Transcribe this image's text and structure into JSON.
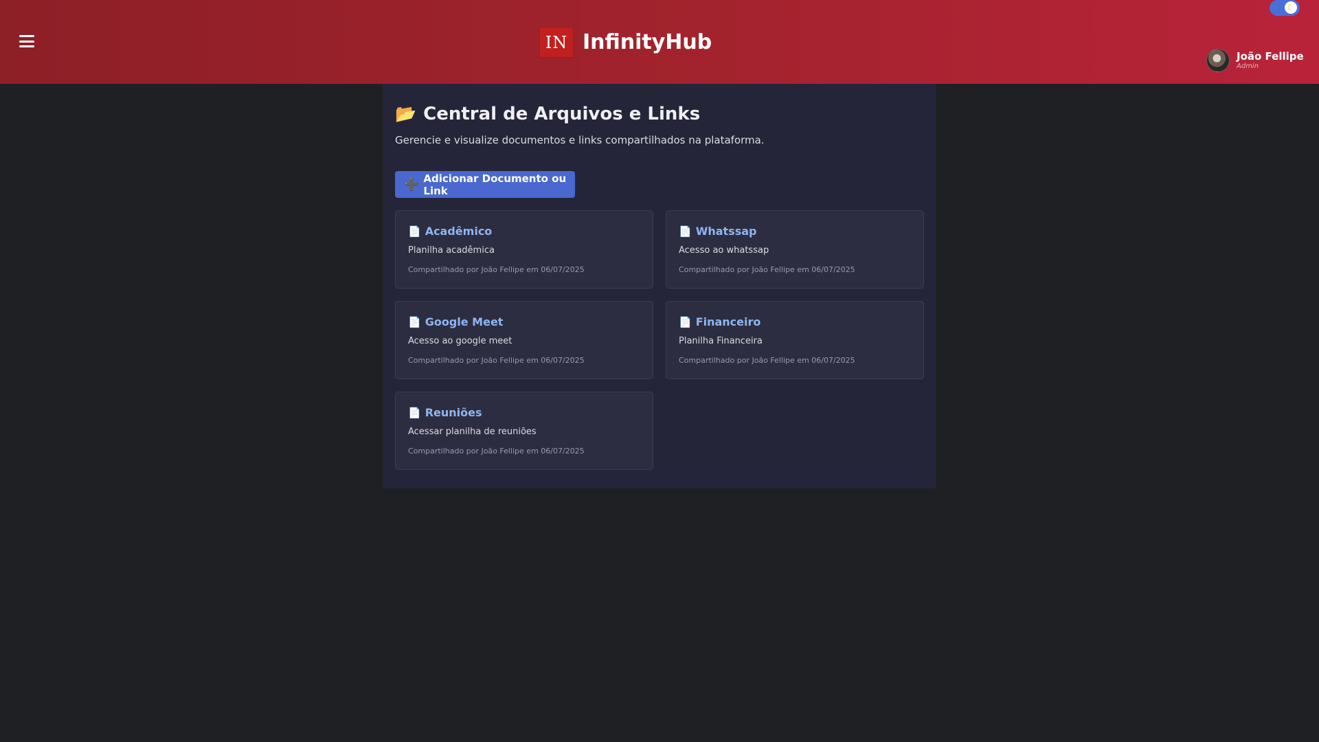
{
  "header": {
    "brand_logo_text": "IN",
    "brand_name": "InfinityHub",
    "theme_icon": "moon-icon",
    "user": {
      "name": "João Fellipe",
      "role": "Admin"
    }
  },
  "page": {
    "title_icon": "📂",
    "title": "Central de Arquivos e Links",
    "subtitle": "Gerencie e visualize documentos e links compartilhados na plataforma.",
    "add_button": {
      "icon": "➕",
      "label": "Adicionar Documento ou Link"
    }
  },
  "documents": [
    {
      "icon": "📄",
      "title": "Acadêmico",
      "description": "Planilha acadêmica",
      "meta": "Compartilhado por João Fellipe em 06/07/2025"
    },
    {
      "icon": "📄",
      "title": "Whatssap",
      "description": "Acesso ao whatssap",
      "meta": "Compartilhado por João Fellipe em 06/07/2025"
    },
    {
      "icon": "📄",
      "title": "Google Meet",
      "description": "Acesso ao google meet",
      "meta": "Compartilhado por João Fellipe em 06/07/2025"
    },
    {
      "icon": "📄",
      "title": "Financeiro",
      "description": "Planilha Financeira",
      "meta": "Compartilhado por João Fellipe em 06/07/2025"
    },
    {
      "icon": "📄",
      "title": "Reuniões",
      "description": "Acessar planilha de reuniões",
      "meta": "Compartilhado por João Fellipe em 06/07/2025"
    }
  ],
  "colors": {
    "header_gradient_start": "#8d1f27",
    "header_gradient_end": "#b9233a",
    "accent_button": "#4a68cf",
    "card_title": "#8eb6f1",
    "page_background": "#1f2023",
    "panel_background": "#25253a"
  }
}
